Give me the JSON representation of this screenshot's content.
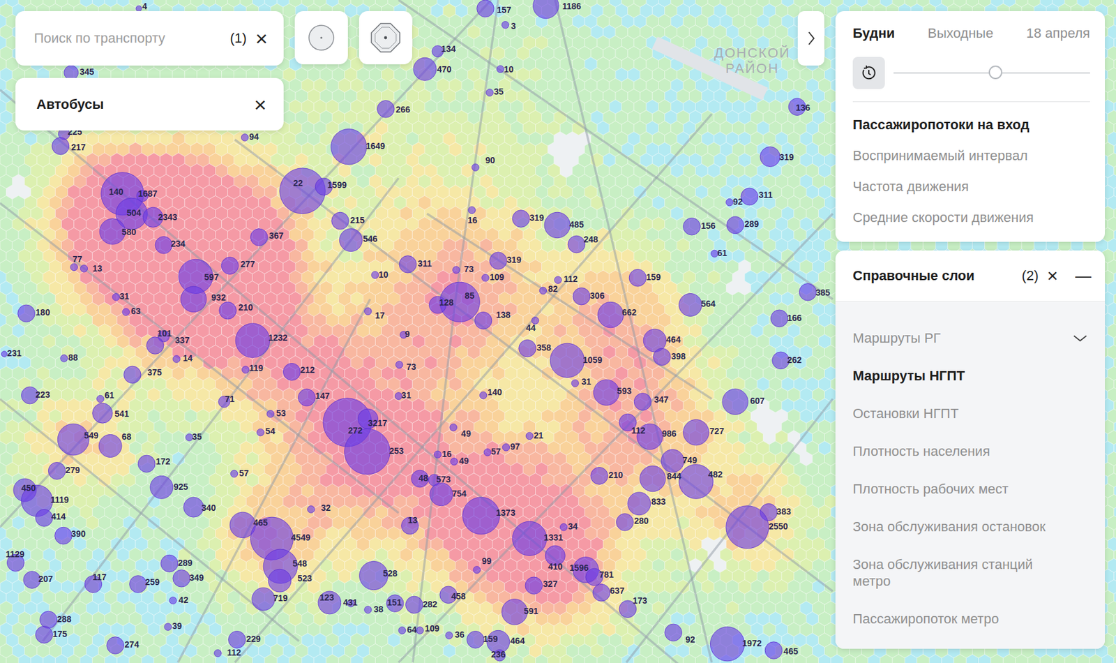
{
  "search": {
    "placeholder": "Поиск по транспорту",
    "count": "(1)",
    "clear": "×"
  },
  "filter_chip": {
    "label": "Автобусы",
    "remove": "×"
  },
  "map_label": [
    "ДОНСКОЙ",
    "РАЙОН"
  ],
  "day_tabs": [
    {
      "label": "Будни",
      "selected": true
    },
    {
      "label": "Выходные",
      "selected": false
    },
    {
      "label": "18 апреля",
      "selected": false
    }
  ],
  "time_slider": {
    "level": 0.52
  },
  "metrics": [
    {
      "label": "Пассажиропотоки на вход",
      "selected": true
    },
    {
      "label": "Воспринимаемый интервал",
      "selected": false
    },
    {
      "label": "Частота движения",
      "selected": false
    },
    {
      "label": "Средние скорости движения",
      "selected": false
    }
  ],
  "layers_panel": {
    "title": "Справочные слои",
    "count": "(2)",
    "clear": "×",
    "collapse": "—",
    "items": [
      {
        "label": "Маршруты РГ",
        "kind": "group",
        "selected": false
      },
      {
        "label": "Маршруты НГПТ",
        "kind": "layer",
        "selected": true
      },
      {
        "label": "Остановки НГПТ",
        "kind": "layer",
        "selected": false
      },
      {
        "label": "Плотность населения",
        "kind": "layer",
        "selected": false
      },
      {
        "label": "Плотность рабочих мест",
        "kind": "layer",
        "selected": false
      },
      {
        "label": "Зона обслуживания остановок",
        "kind": "layer",
        "selected": false
      },
      {
        "label": "Зона обслуживания станций метро",
        "kind": "layer",
        "selected": false
      },
      {
        "label": "Пассажиропоток метро",
        "kind": "layer",
        "selected": false
      }
    ]
  },
  "stops": [
    {
      "label": "4"
    },
    {
      "label": "345"
    },
    {
      "label": "225"
    },
    {
      "label": "217"
    },
    {
      "label": "157"
    },
    {
      "label": "1186"
    },
    {
      "label": "3"
    },
    {
      "label": "134"
    },
    {
      "label": "470"
    },
    {
      "label": "10"
    },
    {
      "label": "35"
    },
    {
      "label": "266"
    },
    {
      "label": "94"
    },
    {
      "label": "1649"
    },
    {
      "label": "90"
    },
    {
      "label": "22"
    },
    {
      "label": "1599"
    },
    {
      "label": "140"
    },
    {
      "label": "1687"
    },
    {
      "label": "504"
    },
    {
      "label": "2343"
    },
    {
      "label": "580"
    },
    {
      "label": "215"
    },
    {
      "label": "16"
    },
    {
      "label": "546"
    },
    {
      "label": "367"
    },
    {
      "label": "234"
    },
    {
      "label": "319"
    },
    {
      "label": "485"
    },
    {
      "label": "248"
    },
    {
      "label": "77"
    },
    {
      "label": "13"
    },
    {
      "label": "277"
    },
    {
      "label": "311"
    },
    {
      "label": "597"
    },
    {
      "label": "932"
    },
    {
      "label": "10"
    },
    {
      "label": "73"
    },
    {
      "label": "319"
    },
    {
      "label": "109"
    },
    {
      "label": "112"
    },
    {
      "label": "159"
    },
    {
      "label": "31"
    },
    {
      "label": "63"
    },
    {
      "label": "210"
    },
    {
      "label": "180"
    },
    {
      "label": "82"
    },
    {
      "label": "85"
    },
    {
      "label": "128"
    },
    {
      "label": "306"
    },
    {
      "label": "17"
    },
    {
      "label": "138"
    },
    {
      "label": "662"
    },
    {
      "label": "564"
    },
    {
      "label": "101"
    },
    {
      "label": "337"
    },
    {
      "label": "1232"
    },
    {
      "label": "9"
    },
    {
      "label": "44"
    },
    {
      "label": "464"
    },
    {
      "label": "398"
    },
    {
      "label": "358"
    },
    {
      "label": "1059"
    },
    {
      "label": "231"
    },
    {
      "label": "88"
    },
    {
      "label": "14"
    },
    {
      "label": "119"
    },
    {
      "label": "212"
    },
    {
      "label": "73"
    },
    {
      "label": "375"
    },
    {
      "label": "31"
    },
    {
      "label": "593"
    },
    {
      "label": "347"
    },
    {
      "label": "223"
    },
    {
      "label": "61"
    },
    {
      "label": "71"
    },
    {
      "label": "147"
    },
    {
      "label": "31"
    },
    {
      "label": "140"
    },
    {
      "label": "607"
    },
    {
      "label": "541"
    },
    {
      "label": "53"
    },
    {
      "label": "3217"
    },
    {
      "label": "272"
    },
    {
      "label": "253"
    },
    {
      "label": "112"
    },
    {
      "label": "986"
    },
    {
      "label": "727"
    },
    {
      "label": "549"
    },
    {
      "label": "68"
    },
    {
      "label": "35"
    },
    {
      "label": "54"
    },
    {
      "label": "49"
    },
    {
      "label": "21"
    },
    {
      "label": "97"
    },
    {
      "label": "57"
    },
    {
      "label": "16"
    },
    {
      "label": "49"
    },
    {
      "label": "172"
    },
    {
      "label": "749"
    },
    {
      "label": "482"
    },
    {
      "label": "279"
    },
    {
      "label": "48"
    },
    {
      "label": "573"
    },
    {
      "label": "210"
    },
    {
      "label": "57"
    },
    {
      "label": "844"
    },
    {
      "label": "925"
    },
    {
      "label": "754"
    },
    {
      "label": "450"
    },
    {
      "label": "1119"
    },
    {
      "label": "833"
    },
    {
      "label": "340"
    },
    {
      "label": "32"
    },
    {
      "label": "1373"
    },
    {
      "label": "414"
    },
    {
      "label": "383"
    },
    {
      "label": "280"
    },
    {
      "label": "13"
    },
    {
      "label": "465"
    },
    {
      "label": "34"
    },
    {
      "label": "2550"
    },
    {
      "label": "390"
    },
    {
      "label": "4549"
    },
    {
      "label": "1331"
    },
    {
      "label": "1129"
    },
    {
      "label": "289"
    },
    {
      "label": "548"
    },
    {
      "label": "410"
    },
    {
      "label": "1596"
    },
    {
      "label": "99"
    },
    {
      "label": "781"
    },
    {
      "label": "528"
    },
    {
      "label": "117"
    },
    {
      "label": "207"
    },
    {
      "label": "349"
    },
    {
      "label": "259"
    },
    {
      "label": "523"
    },
    {
      "label": "327"
    },
    {
      "label": "637"
    },
    {
      "label": "458"
    },
    {
      "label": "719"
    },
    {
      "label": "123"
    },
    {
      "label": "151"
    },
    {
      "label": "282"
    },
    {
      "label": "431"
    },
    {
      "label": "42"
    },
    {
      "label": "173"
    },
    {
      "label": "38"
    },
    {
      "label": "591"
    },
    {
      "label": "288"
    },
    {
      "label": "39"
    },
    {
      "label": "64"
    },
    {
      "label": "109"
    },
    {
      "label": "175"
    },
    {
      "label": "36"
    },
    {
      "label": "229"
    },
    {
      "label": "159"
    },
    {
      "label": "464"
    },
    {
      "label": "92"
    },
    {
      "label": "274"
    },
    {
      "label": "1972"
    },
    {
      "label": "465"
    },
    {
      "label": "112"
    },
    {
      "label": "136"
    },
    {
      "label": "319"
    },
    {
      "label": "311"
    },
    {
      "label": "92"
    },
    {
      "label": "289"
    },
    {
      "label": "156"
    },
    {
      "label": "61"
    },
    {
      "label": "385"
    },
    {
      "label": "166"
    },
    {
      "label": "262"
    },
    {
      "label": "236"
    }
  ]
}
